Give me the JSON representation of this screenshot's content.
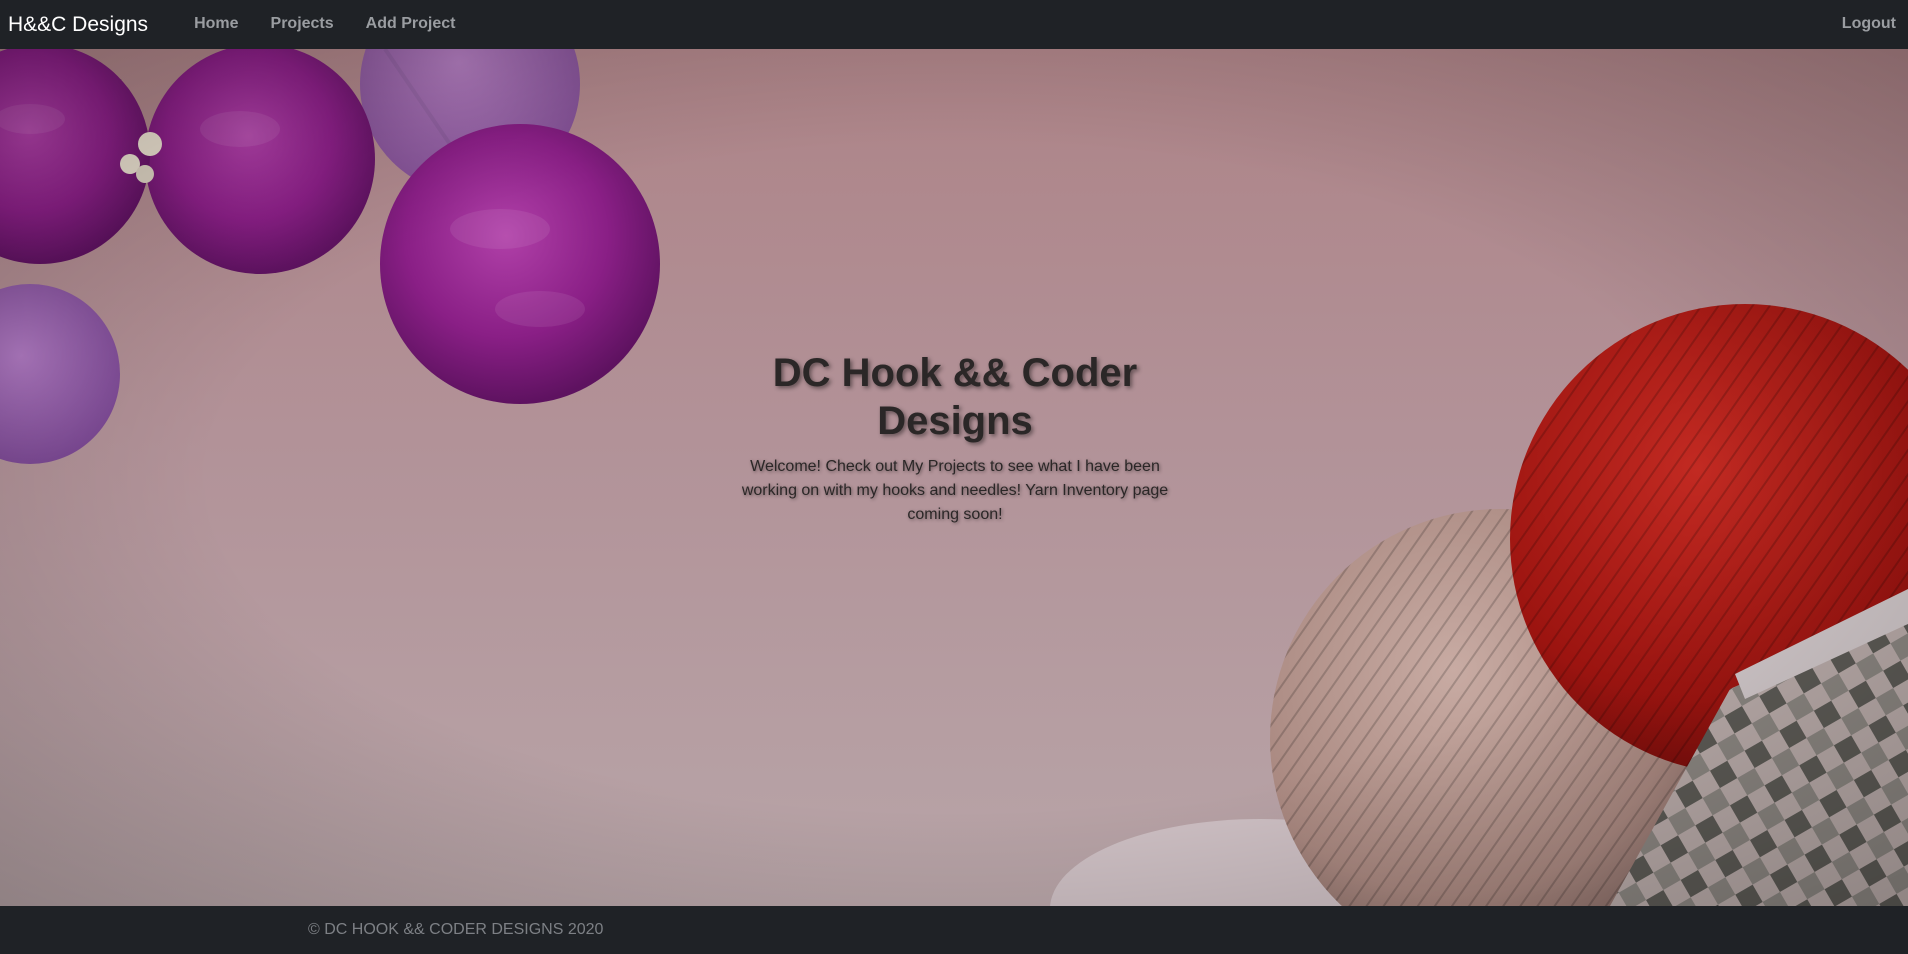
{
  "navbar": {
    "brand": "H&&C Designs",
    "links": [
      "Home",
      "Projects",
      "Add Project"
    ],
    "logout": "Logout"
  },
  "hero": {
    "title": "DC Hook && Coder Designs",
    "text": "Welcome! Check out My Projects to see what I have been working on with my hooks and needles! Yarn Inventory page coming soon!"
  },
  "footer": {
    "text": "© DC HOOK && CODER DESIGNS 2020"
  },
  "colors": {
    "navbar_bg": "#1f2226",
    "nav_link": "#9a9da1",
    "brand": "#ffffff"
  }
}
